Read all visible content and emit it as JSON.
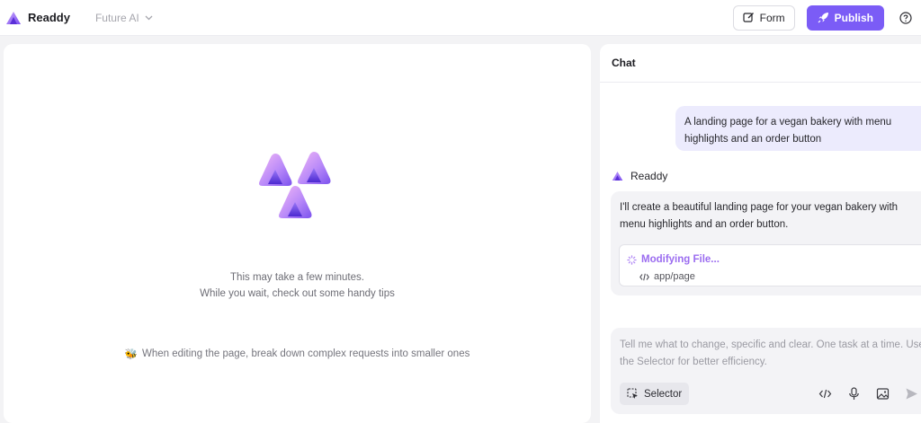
{
  "header": {
    "brand_name": "Readdy",
    "project_name": "Future AI",
    "form_label": "Form",
    "publish_label": "Publish"
  },
  "colors": {
    "accent": "#7b5cf6",
    "user_bubble": "#ecebfd",
    "status": "#9b6cf0"
  },
  "preview": {
    "loading_line1": "This may take a few minutes.",
    "loading_line2": "While you wait, check out some handy tips",
    "tip_icon": "🐝",
    "tip_text": "When editing the page, break down complex requests into smaller ones"
  },
  "chat": {
    "title": "Chat",
    "user_message": "A landing page for a vegan bakery with menu highlights and an order button",
    "assistant_name": "Readdy",
    "assistant_message": "I'll create a beautiful landing page for your vegan bakery with menu highlights and an order button.",
    "file_status": "Modifying File...",
    "file_path": "app/page",
    "input_placeholder": "Tell me what to change, specific and clear. One task at a time. Use the Selector for better efficiency.",
    "selector_label": "Selector"
  },
  "icons": {
    "logo": "readdy-logo-icon",
    "chevron": "chevron-down-icon",
    "form": "edit-icon",
    "publish": "rocket-icon",
    "help": "help-circle-icon",
    "selector": "selector-icon",
    "code": "code-icon",
    "mic": "microphone-icon",
    "image": "image-icon",
    "send": "send-icon"
  }
}
